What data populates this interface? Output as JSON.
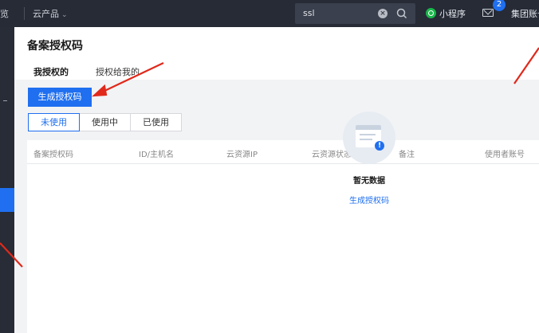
{
  "topbar": {
    "crumb": "览",
    "products_label": "云产品",
    "search_value": "ssl",
    "mini_program_label": "小程序",
    "notification_count": "2",
    "account_label": "集团账号"
  },
  "page": {
    "title": "备案授权码",
    "tabs": [
      {
        "label": "我授权的"
      },
      {
        "label": "授权给我的"
      }
    ],
    "generate_button": "生成授权码",
    "status_filters": [
      {
        "label": "未使用"
      },
      {
        "label": "使用中"
      },
      {
        "label": "已使用"
      }
    ],
    "table_columns": [
      "备案授权码",
      "ID/主机名",
      "云资源IP",
      "云资源状态",
      "备注",
      "使用者账号"
    ],
    "empty_text": "暂无数据",
    "empty_link": "生成授权码"
  },
  "colors": {
    "accent": "#1f6ff0",
    "topbar_bg": "#262b36",
    "annotation": "#e0291b"
  },
  "icons": [
    "search-icon",
    "clear-icon",
    "mini-program-icon",
    "mail-icon",
    "empty-data-icon",
    "chevron-down-icon"
  ]
}
